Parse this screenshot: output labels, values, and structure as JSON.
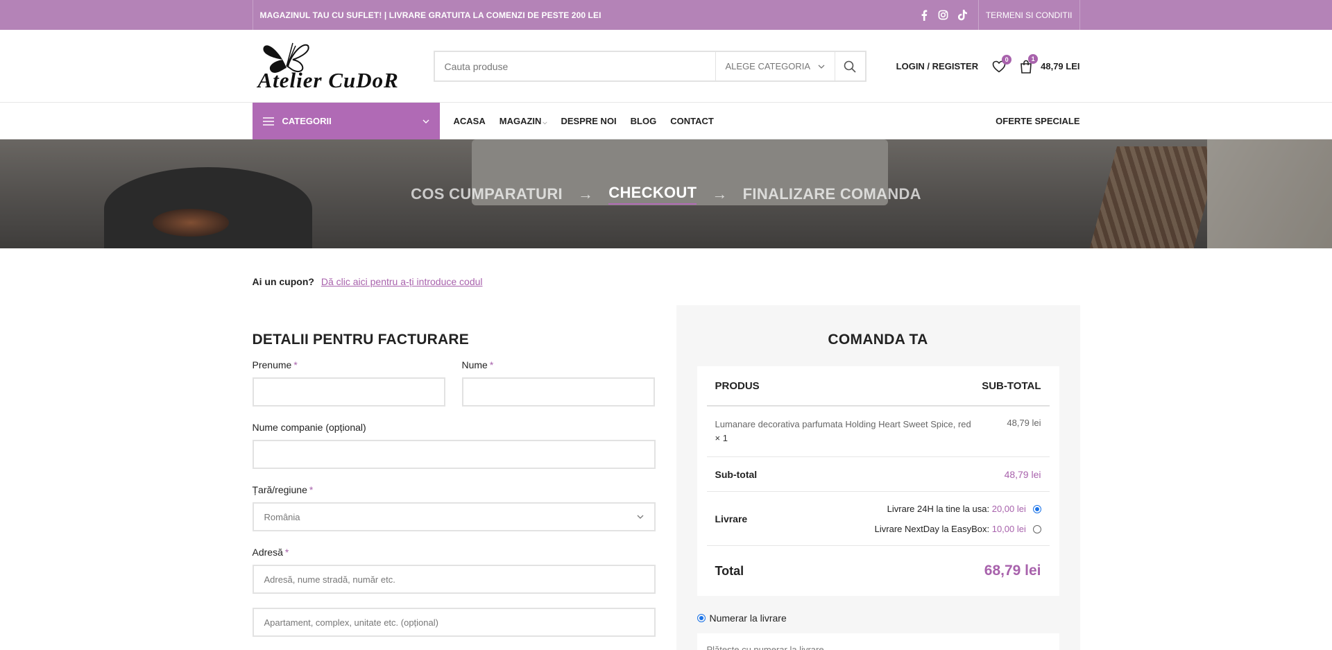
{
  "topbar": {
    "promo": "MAGAZINUL TAU CU SUFLET! | LIVRARE GRATUITA LA COMENZI DE PESTE 200 LEI",
    "social": [
      "facebook-icon",
      "instagram-icon",
      "tiktok-icon"
    ],
    "terms": "TERMENI SI CONDITII"
  },
  "header": {
    "logo_text": "Atelier CuDoR",
    "search_placeholder": "Cauta produse",
    "category_select": "ALEGE CATEGORIA",
    "login": "LOGIN / REGISTER",
    "wishlist_count": "0",
    "cart_count": "1",
    "cart_total": "48,79 LEI"
  },
  "nav": {
    "categories": "CATEGORII",
    "items": [
      "ACASA",
      "MAGAZIN",
      "DESPRE NOI",
      "BLOG",
      "CONTACT"
    ],
    "specials": "OFERTE SPECIALE"
  },
  "hero": {
    "step1": "COS CUMPARATURI",
    "step2": "CHECKOUT",
    "step3": "FINALIZARE COMANDA",
    "arrow": "→"
  },
  "coupon": {
    "question": "Ai un cupon?",
    "link": "Dă clic aici pentru a-ți introduce codul"
  },
  "billing": {
    "title": "DETALII PENTRU FACTURARE",
    "first_name": "Prenume",
    "last_name": "Nume",
    "company": "Nume companie (opțional)",
    "country_label": "Țară/regiune",
    "country_value": "România",
    "address_label": "Adresă",
    "address_placeholder": "Adresă, nume stradă, număr etc.",
    "address2_placeholder": "Apartament, complex, unitate etc. (opțional)",
    "required_mark": "*"
  },
  "order": {
    "title": "COMANDA TA",
    "col_product": "PRODUS",
    "col_subtotal": "SUB-TOTAL",
    "product_name": "Lumanare decorativa parfumata Holding Heart Sweet Spice, red",
    "product_qty": "× 1",
    "product_price": "48,79 lei",
    "subtotal_label": "Sub-total",
    "subtotal_value": "48,79 lei",
    "shipping_label": "Livrare",
    "ship1_label": "Livrare 24H la tine la usa:",
    "ship1_price": "20,00 lei",
    "ship2_label": "Livrare NextDay la EasyBox:",
    "ship2_price": "10,00 lei",
    "total_label": "Total",
    "total_value": "68,79 lei",
    "payment_method": "Numerar la livrare",
    "payment_info": "Plătește cu numerar la livrare."
  },
  "colors": {
    "brand": "#b06ab5",
    "topbar": "#b483b7",
    "accent_text": "#a862ac"
  }
}
